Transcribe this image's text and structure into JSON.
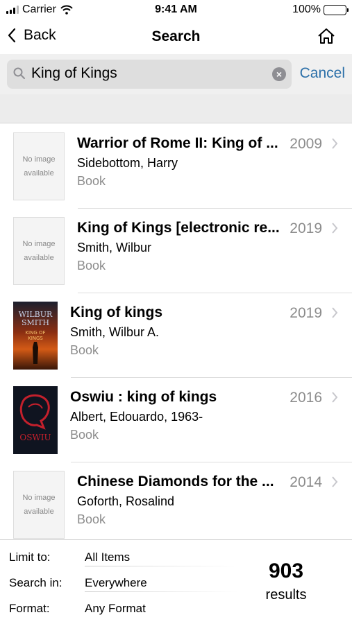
{
  "status": {
    "carrier": "Carrier",
    "time": "9:41 AM",
    "battery": "100%"
  },
  "nav": {
    "back": "Back",
    "title": "Search",
    "home_icon": "home-icon"
  },
  "search": {
    "value": "King of Kings",
    "cancel": "Cancel"
  },
  "results": [
    {
      "title": "Warrior of Rome II: King of ...",
      "author": "Sidebottom, Harry",
      "format": "Book",
      "year": "2009",
      "image": "none",
      "no_image_line1": "No image",
      "no_image_line2": "available"
    },
    {
      "title": "King of Kings [electronic re...",
      "author": "Smith, Wilbur",
      "format": "Book",
      "year": "2019",
      "image": "none",
      "no_image_line1": "No image",
      "no_image_line2": "available"
    },
    {
      "title": "King of kings",
      "author": "Smith, Wilbur A.",
      "format": "Book",
      "year": "2019",
      "image": "cover",
      "cover_line1": "WILBUR",
      "cover_line2": "SMITH",
      "cover_line3": "KING OF",
      "cover_line4": "KINGS"
    },
    {
      "title": "Oswiu : king of kings",
      "author": "Albert, Edouardo, 1963-",
      "format": "Book",
      "year": "2016",
      "image": "cover",
      "cover_line1": "OSWIU"
    },
    {
      "title": "Chinese Diamonds for the ...",
      "author": "Goforth, Rosalind",
      "format": "Book",
      "year": "2014",
      "image": "none",
      "no_image_line1": "No image",
      "no_image_line2": "available"
    }
  ],
  "footer": {
    "limit_label": "Limit to:",
    "limit_value": "All Items",
    "search_label": "Search in:",
    "search_value": "Everywhere",
    "format_label": "Format:",
    "format_value": "Any Format",
    "count": "903",
    "count_label": "results"
  },
  "colors": {
    "accent": "#2b6fa8",
    "secondary_text": "#8c8c8c",
    "search_bg": "#f0f0f0"
  }
}
